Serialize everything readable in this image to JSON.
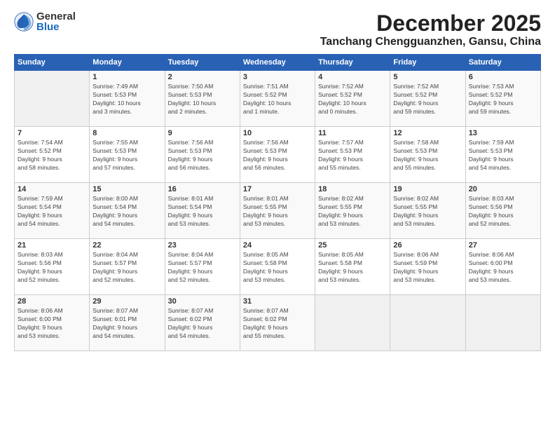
{
  "logo": {
    "general": "General",
    "blue": "Blue"
  },
  "title": {
    "month": "December 2025",
    "location": "Tanchang Chengguanzhen, Gansu, China"
  },
  "headers": [
    "Sunday",
    "Monday",
    "Tuesday",
    "Wednesday",
    "Thursday",
    "Friday",
    "Saturday"
  ],
  "weeks": [
    [
      {
        "day": "",
        "info": ""
      },
      {
        "day": "1",
        "info": "Sunrise: 7:49 AM\nSunset: 5:53 PM\nDaylight: 10 hours\nand 3 minutes."
      },
      {
        "day": "2",
        "info": "Sunrise: 7:50 AM\nSunset: 5:53 PM\nDaylight: 10 hours\nand 2 minutes."
      },
      {
        "day": "3",
        "info": "Sunrise: 7:51 AM\nSunset: 5:52 PM\nDaylight: 10 hours\nand 1 minute."
      },
      {
        "day": "4",
        "info": "Sunrise: 7:52 AM\nSunset: 5:52 PM\nDaylight: 10 hours\nand 0 minutes."
      },
      {
        "day": "5",
        "info": "Sunrise: 7:52 AM\nSunset: 5:52 PM\nDaylight: 9 hours\nand 59 minutes."
      },
      {
        "day": "6",
        "info": "Sunrise: 7:53 AM\nSunset: 5:52 PM\nDaylight: 9 hours\nand 59 minutes."
      }
    ],
    [
      {
        "day": "7",
        "info": "Sunrise: 7:54 AM\nSunset: 5:52 PM\nDaylight: 9 hours\nand 58 minutes."
      },
      {
        "day": "8",
        "info": "Sunrise: 7:55 AM\nSunset: 5:53 PM\nDaylight: 9 hours\nand 57 minutes."
      },
      {
        "day": "9",
        "info": "Sunrise: 7:56 AM\nSunset: 5:53 PM\nDaylight: 9 hours\nand 56 minutes."
      },
      {
        "day": "10",
        "info": "Sunrise: 7:56 AM\nSunset: 5:53 PM\nDaylight: 9 hours\nand 56 minutes."
      },
      {
        "day": "11",
        "info": "Sunrise: 7:57 AM\nSunset: 5:53 PM\nDaylight: 9 hours\nand 55 minutes."
      },
      {
        "day": "12",
        "info": "Sunrise: 7:58 AM\nSunset: 5:53 PM\nDaylight: 9 hours\nand 55 minutes."
      },
      {
        "day": "13",
        "info": "Sunrise: 7:59 AM\nSunset: 5:53 PM\nDaylight: 9 hours\nand 54 minutes."
      }
    ],
    [
      {
        "day": "14",
        "info": "Sunrise: 7:59 AM\nSunset: 5:54 PM\nDaylight: 9 hours\nand 54 minutes."
      },
      {
        "day": "15",
        "info": "Sunrise: 8:00 AM\nSunset: 5:54 PM\nDaylight: 9 hours\nand 54 minutes."
      },
      {
        "day": "16",
        "info": "Sunrise: 8:01 AM\nSunset: 5:54 PM\nDaylight: 9 hours\nand 53 minutes."
      },
      {
        "day": "17",
        "info": "Sunrise: 8:01 AM\nSunset: 5:55 PM\nDaylight: 9 hours\nand 53 minutes."
      },
      {
        "day": "18",
        "info": "Sunrise: 8:02 AM\nSunset: 5:55 PM\nDaylight: 9 hours\nand 53 minutes."
      },
      {
        "day": "19",
        "info": "Sunrise: 8:02 AM\nSunset: 5:55 PM\nDaylight: 9 hours\nand 53 minutes."
      },
      {
        "day": "20",
        "info": "Sunrise: 8:03 AM\nSunset: 5:56 PM\nDaylight: 9 hours\nand 52 minutes."
      }
    ],
    [
      {
        "day": "21",
        "info": "Sunrise: 8:03 AM\nSunset: 5:56 PM\nDaylight: 9 hours\nand 52 minutes."
      },
      {
        "day": "22",
        "info": "Sunrise: 8:04 AM\nSunset: 5:57 PM\nDaylight: 9 hours\nand 52 minutes."
      },
      {
        "day": "23",
        "info": "Sunrise: 8:04 AM\nSunset: 5:57 PM\nDaylight: 9 hours\nand 52 minutes."
      },
      {
        "day": "24",
        "info": "Sunrise: 8:05 AM\nSunset: 5:58 PM\nDaylight: 9 hours\nand 53 minutes."
      },
      {
        "day": "25",
        "info": "Sunrise: 8:05 AM\nSunset: 5:58 PM\nDaylight: 9 hours\nand 53 minutes."
      },
      {
        "day": "26",
        "info": "Sunrise: 8:06 AM\nSunset: 5:59 PM\nDaylight: 9 hours\nand 53 minutes."
      },
      {
        "day": "27",
        "info": "Sunrise: 8:06 AM\nSunset: 6:00 PM\nDaylight: 9 hours\nand 53 minutes."
      }
    ],
    [
      {
        "day": "28",
        "info": "Sunrise: 8:06 AM\nSunset: 6:00 PM\nDaylight: 9 hours\nand 53 minutes."
      },
      {
        "day": "29",
        "info": "Sunrise: 8:07 AM\nSunset: 6:01 PM\nDaylight: 9 hours\nand 54 minutes."
      },
      {
        "day": "30",
        "info": "Sunrise: 8:07 AM\nSunset: 6:02 PM\nDaylight: 9 hours\nand 54 minutes."
      },
      {
        "day": "31",
        "info": "Sunrise: 8:07 AM\nSunset: 6:02 PM\nDaylight: 9 hours\nand 55 minutes."
      },
      {
        "day": "",
        "info": ""
      },
      {
        "day": "",
        "info": ""
      },
      {
        "day": "",
        "info": ""
      }
    ]
  ]
}
